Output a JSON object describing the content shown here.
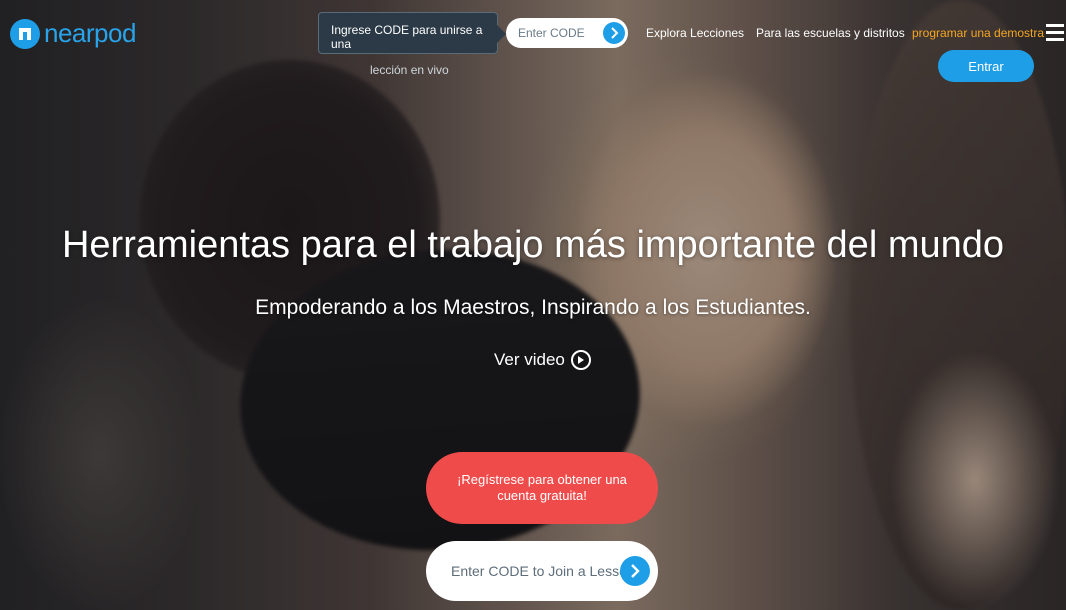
{
  "header": {
    "logo_text": "nearpod",
    "code_prompt_line1": "Ingrese CODE para unirse a una",
    "code_prompt_line2": "lección en vivo",
    "code_placeholder": "Enter CODE",
    "nav_explore": "Explora Lecciones",
    "nav_schools": "Para las escuelas y distritos",
    "nav_demo": "programar una demostración",
    "login_label": "Entrar"
  },
  "hero": {
    "headline": "Herramientas para el trabajo más importante del mundo",
    "subheadline": "Empoderando a los Maestros, Inspirando a los Estudiantes.",
    "video_label": "Ver video",
    "signup_label": "¡Regístrese para obtener una cuenta gratuita!",
    "join_placeholder": "Enter CODE to Join a Lesson"
  },
  "colors": {
    "brand_blue": "#1f9ee8",
    "signup_red": "#ef4b4b",
    "demo_orange": "#f5a623"
  },
  "icons": [
    "nearpod-logo-icon",
    "chevron-right-icon",
    "hamburger-menu-icon",
    "play-icon"
  ]
}
